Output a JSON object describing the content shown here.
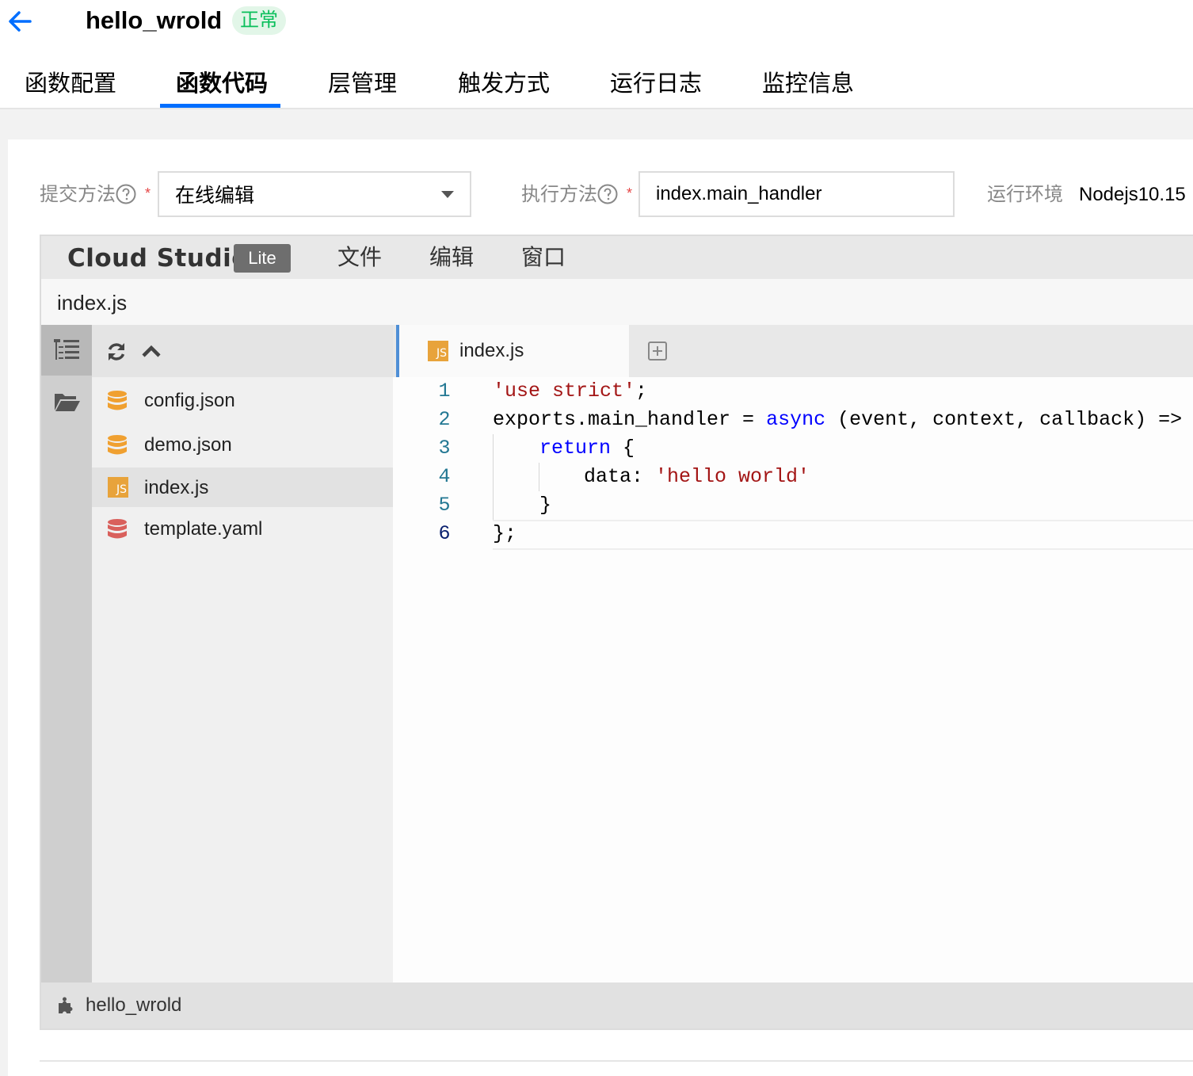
{
  "header": {
    "title": "hello_wrold",
    "status": "正常"
  },
  "tabs": [
    {
      "label": "函数配置"
    },
    {
      "label": "函数代码"
    },
    {
      "label": "层管理"
    },
    {
      "label": "触发方式"
    },
    {
      "label": "运行日志"
    },
    {
      "label": "监控信息"
    }
  ],
  "form": {
    "submit_method_label": "提交方法",
    "submit_method_value": "在线编辑",
    "handler_label": "执行方法",
    "handler_value": "index.main_handler",
    "runtime_label": "运行环境",
    "runtime_value": "Nodejs10.15",
    "required_mark": "*"
  },
  "ide": {
    "brand": "Cloud Studio",
    "badge": "Lite",
    "menu": [
      {
        "label": "文件"
      },
      {
        "label": "编辑"
      },
      {
        "label": "窗口"
      }
    ],
    "path": "index.js",
    "files": [
      {
        "name": "config.json",
        "icon": "database-icon"
      },
      {
        "name": "demo.json",
        "icon": "database-icon"
      },
      {
        "name": "index.js",
        "icon": "js-file-icon",
        "selected": true
      },
      {
        "name": "template.yaml",
        "icon": "database-icon"
      }
    ],
    "open_tab": "index.js",
    "js_icon_text": "JS",
    "line_numbers": [
      "1",
      "2",
      "3",
      "4",
      "5",
      "6"
    ],
    "code": {
      "l1_str": "'use strict'",
      "l1_end": ";",
      "l2_a": "exports.main_handler = ",
      "l2_kw": "async",
      "l2_b": " (event, context, callback) => {",
      "l3_kw": "return",
      "l3_b": " {",
      "l4_a": "data: ",
      "l4_str": "'hello world'",
      "l5": "}",
      "l6": "};"
    },
    "status_text": "hello_wrold"
  },
  "colors": {
    "accent": "#006eff",
    "status_green": "#0abf5b",
    "json_icon": "#f0a030",
    "yaml_icon": "#d9605c",
    "js_icon": "#e8a33b"
  }
}
